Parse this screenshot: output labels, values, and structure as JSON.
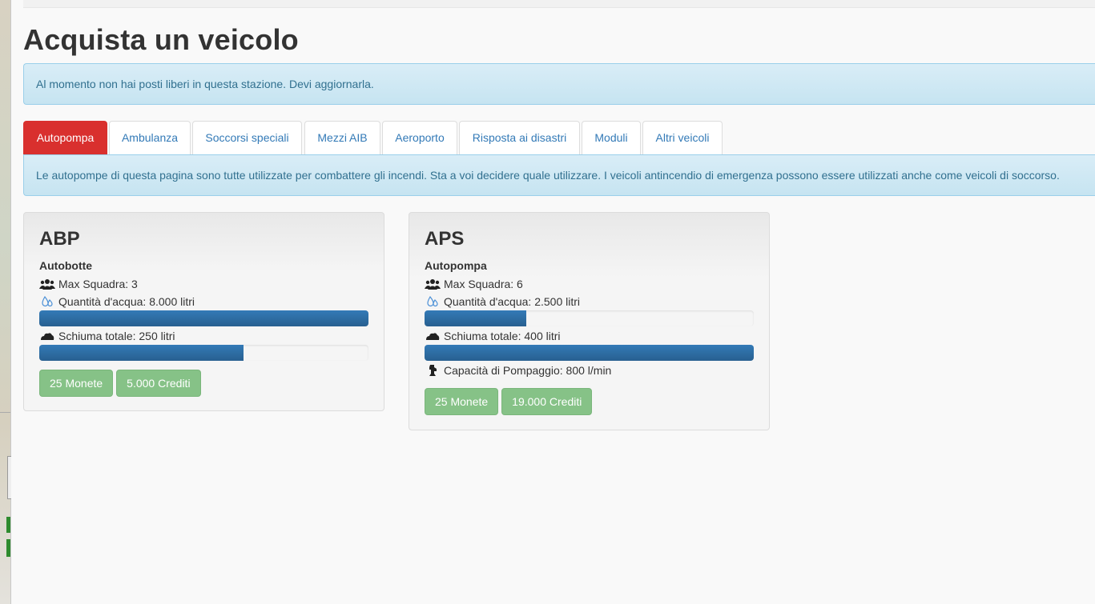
{
  "page": {
    "title": "Acquista un veicolo"
  },
  "alert_top": {
    "text": "Al momento non hai posti liberi in questa stazione. Devi aggiornarla."
  },
  "tabs": [
    {
      "label": "Autopompa",
      "active": true
    },
    {
      "label": "Ambulanza",
      "active": false
    },
    {
      "label": "Soccorsi speciali",
      "active": false
    },
    {
      "label": "Mezzi AIB",
      "active": false
    },
    {
      "label": "Aeroporto",
      "active": false
    },
    {
      "label": "Risposta ai disastri",
      "active": false
    },
    {
      "label": "Moduli",
      "active": false
    },
    {
      "label": "Altri veicoli",
      "active": false
    }
  ],
  "alert_tab": {
    "text": "Le autopompe di questa pagina sono tutte utilizzate per combattere gli incendi. Sta a voi decidere quale utilizzare. I veicoli antincendio di emergenza possono essere utilizzati anche come veicoli di soccorso."
  },
  "vehicles": [
    {
      "code": "ABP",
      "type": "Autobotte",
      "crew": "Max Squadra: 3",
      "water": "Quantità d'acqua: 8.000 litri",
      "water_fraction": 1.0,
      "foam": "Schiuma totale: 250 litri",
      "foam_fraction": 0.62,
      "coins_label": "25 Monete",
      "credits_label": "5.000 Crediti"
    },
    {
      "code": "APS",
      "type": "Autopompa",
      "crew": "Max Squadra: 6",
      "water": "Quantità d'acqua: 2.500 litri",
      "water_fraction": 0.31,
      "foam": "Schiuma totale: 400 litri",
      "foam_fraction": 1.0,
      "pump": "Capacità di Pompaggio: 800 l/min",
      "coins_label": "25 Monete",
      "credits_label": "19.000 Crediti"
    }
  ],
  "icons": {
    "crew": "users-icon",
    "water": "water-drop-icon",
    "foam": "foam-icon",
    "pump": "pump-icon"
  },
  "colors": {
    "active_tab": "#d9302e",
    "progress": "#337ab7",
    "buy_button": "#86c287",
    "alert_bg": "#d9edf7",
    "alert_text": "#31708f"
  }
}
